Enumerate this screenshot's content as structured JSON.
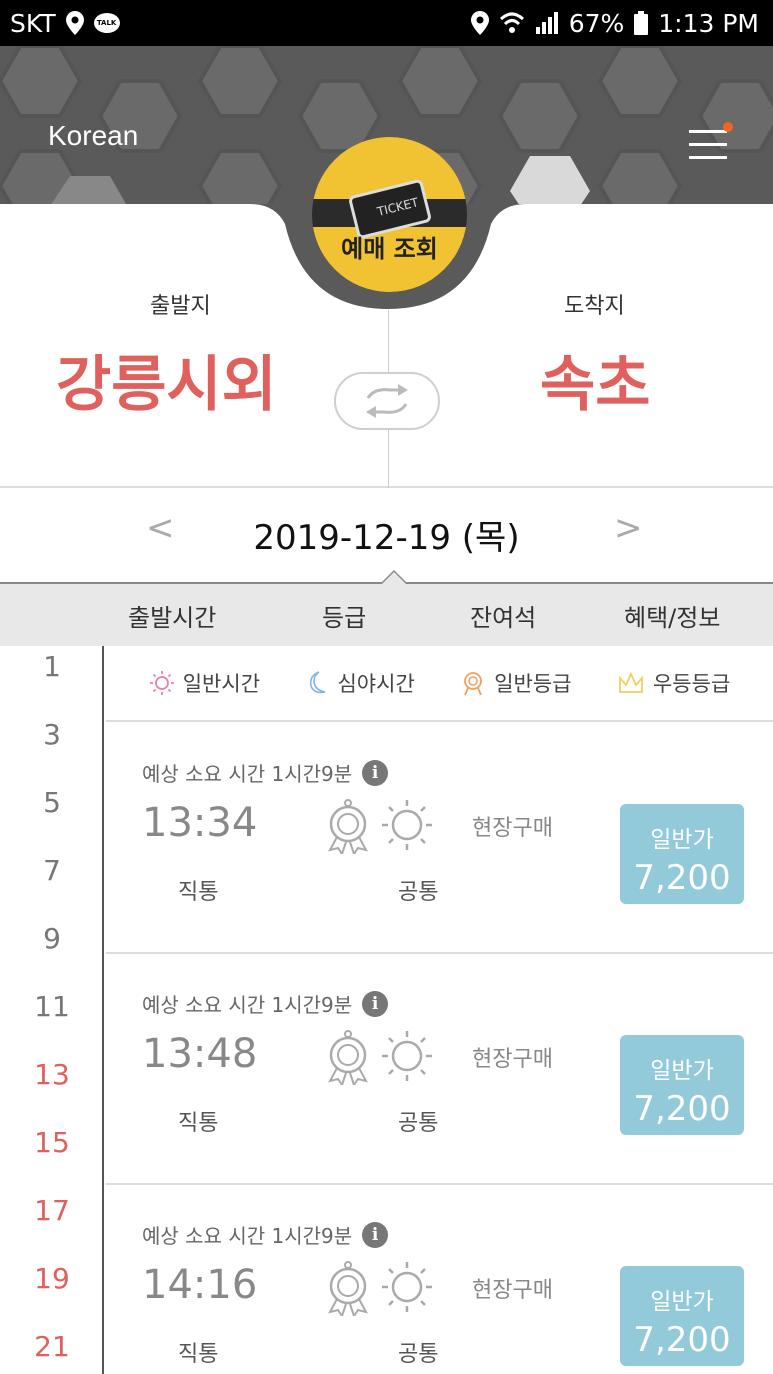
{
  "status_bar": {
    "carrier": "SKT",
    "talk_badge": "TALK",
    "battery": "67%",
    "time": "1:13 PM"
  },
  "header": {
    "language": "Korean",
    "ticket_lookup_label": "예매 조회",
    "ticket_card_text": "TICKET",
    "accent_color": "#f1c232",
    "notification_dot_color": "#f26522"
  },
  "route": {
    "departure_label": "출발지",
    "departure_city": "강릉시외",
    "arrival_label": "도착지",
    "arrival_city": "속초",
    "city_color": "#e0605e"
  },
  "date": {
    "value": "2019-12-19 (목)",
    "prev": "<",
    "next": ">"
  },
  "columns": [
    "출발시간",
    "등급",
    "잔여석",
    "혜택/정보"
  ],
  "hours": [
    {
      "label": "1",
      "red": false
    },
    {
      "label": "3",
      "red": false
    },
    {
      "label": "5",
      "red": false
    },
    {
      "label": "7",
      "red": false
    },
    {
      "label": "9",
      "red": false
    },
    {
      "label": "11",
      "red": false
    },
    {
      "label": "13",
      "red": true
    },
    {
      "label": "15",
      "red": true
    },
    {
      "label": "17",
      "red": true
    },
    {
      "label": "19",
      "red": true
    },
    {
      "label": "21",
      "red": true
    }
  ],
  "legend": [
    {
      "icon": "sun-icon",
      "label": "일반시간",
      "color": "#e87fb0"
    },
    {
      "icon": "moon-icon",
      "label": "심야시간",
      "color": "#7fb6e8"
    },
    {
      "icon": "medal-icon",
      "label": "일반등급",
      "color": "#f0a060"
    },
    {
      "icon": "crown-icon",
      "label": "우등등급",
      "color": "#f1d060"
    }
  ],
  "schedules": [
    {
      "duration": "예상 소요 시간 1시간9분",
      "time": "13:34",
      "route_type": "직통",
      "grade": "공통",
      "purchase": "현장구매",
      "price_type": "일반가",
      "price": "7,200"
    },
    {
      "duration": "예상 소요 시간 1시간9분",
      "time": "13:48",
      "route_type": "직통",
      "grade": "공통",
      "purchase": "현장구매",
      "price_type": "일반가",
      "price": "7,200"
    },
    {
      "duration": "예상 소요 시간 1시간9분",
      "time": "14:16",
      "route_type": "직통",
      "grade": "공통",
      "purchase": "현장구매",
      "price_type": "일반가",
      "price": "7,200"
    }
  ],
  "price_box_color": "#92cad9"
}
